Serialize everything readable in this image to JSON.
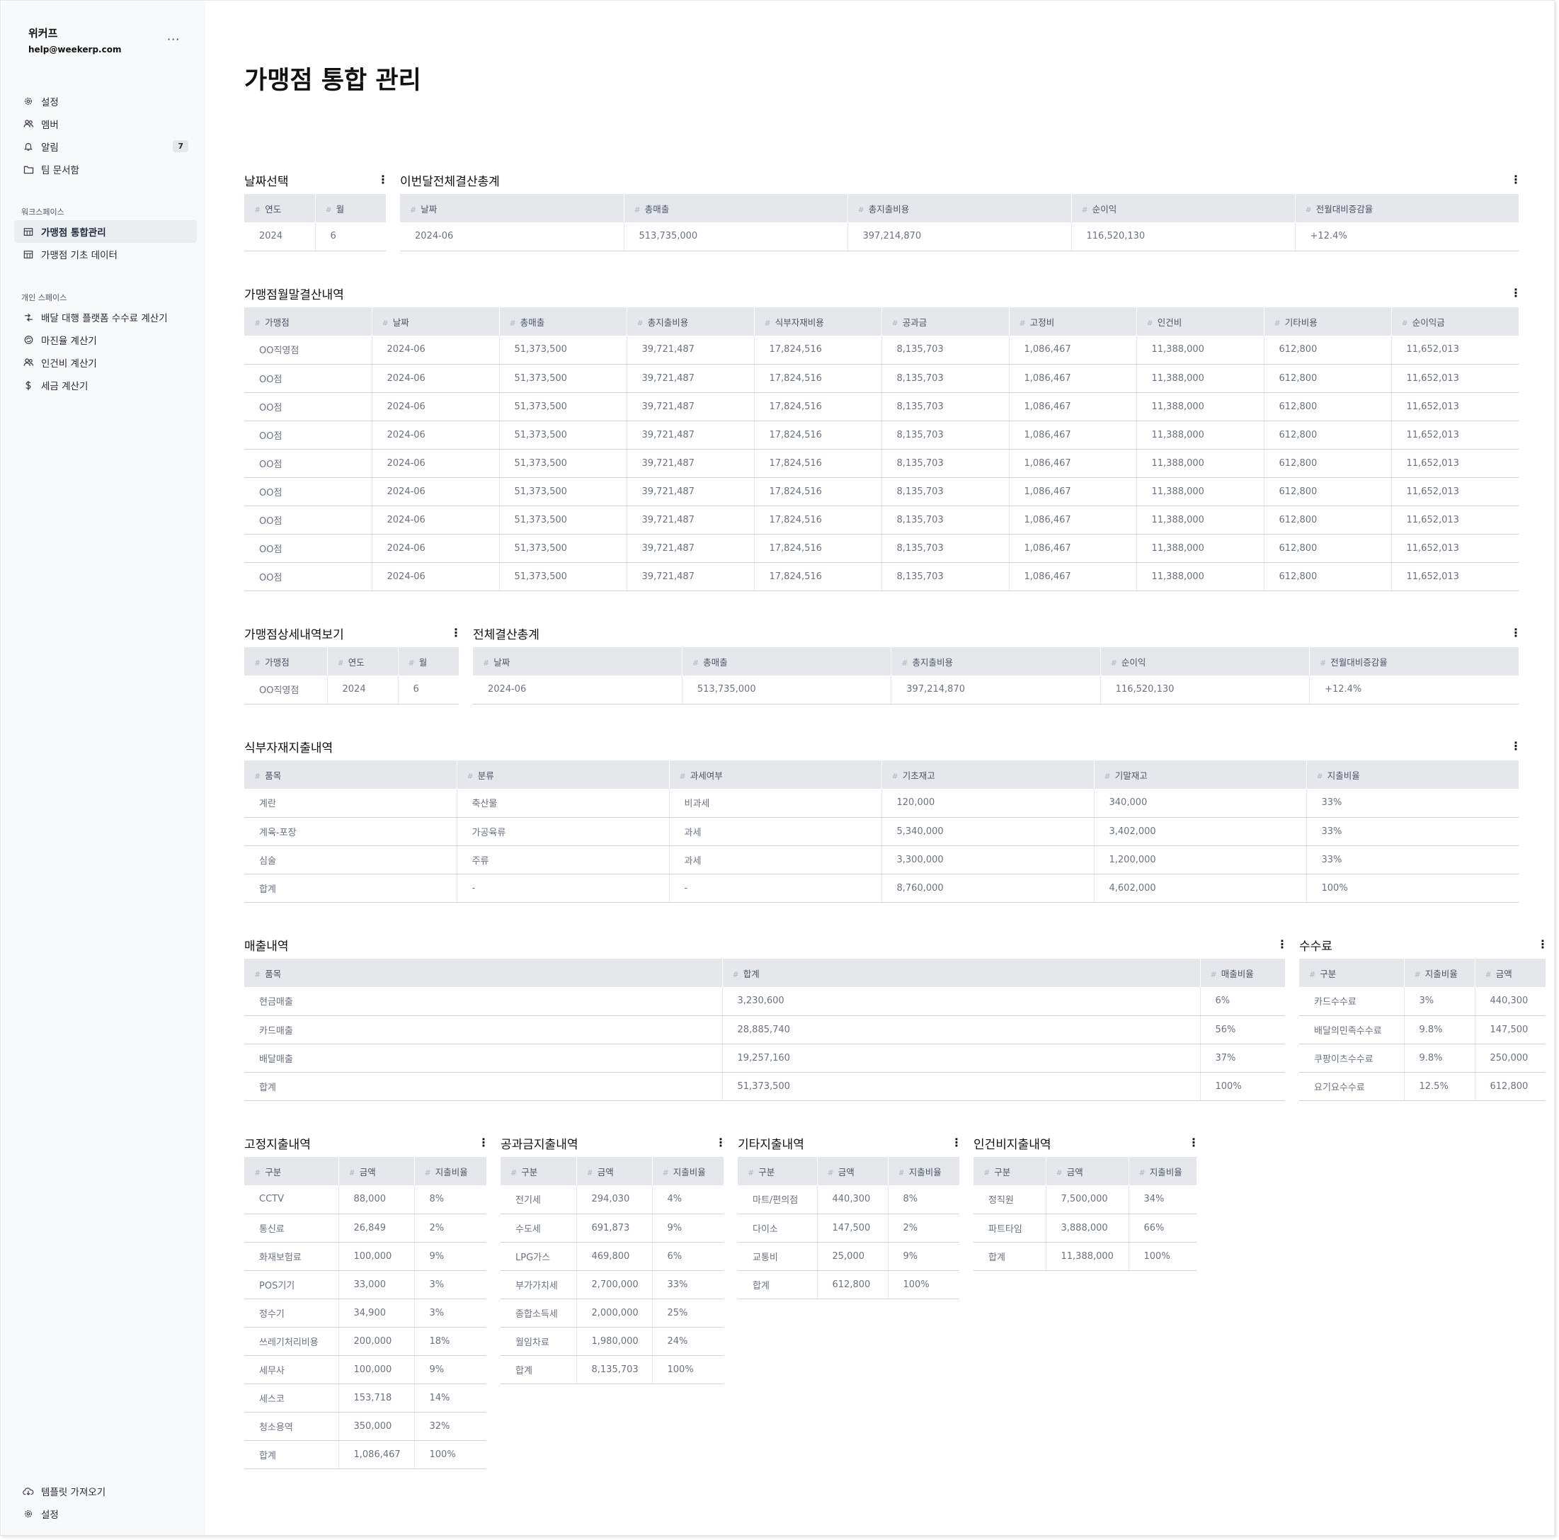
{
  "sidebar": {
    "workspace_name": "위커프",
    "email": "help@weekerp.com",
    "more": "···",
    "top_items": [
      {
        "label": "설정",
        "icon": "gear-icon"
      },
      {
        "label": "멤버",
        "icon": "users-icon"
      },
      {
        "label": "알림",
        "icon": "bell-icon",
        "badge": "7"
      },
      {
        "label": "팀 문서함",
        "icon": "folder-icon"
      }
    ],
    "workspace_caption": "워크스페이스",
    "workspace_items": [
      {
        "label": "가맹점 통합관리",
        "icon": "table-icon",
        "active": true
      },
      {
        "label": "가맹점 기초 데이터",
        "icon": "table-icon"
      }
    ],
    "personal_caption": "개인 스페이스",
    "personal_items": [
      {
        "label": "배달 대행 플랫폼 수수료 계산기",
        "icon": "arrows-icon"
      },
      {
        "label": "마진율 계산기",
        "icon": "coins-icon"
      },
      {
        "label": "인건비 계산기",
        "icon": "users-icon"
      },
      {
        "label": "세금 계산기",
        "icon": "dollar-icon"
      }
    ],
    "bottom_items": [
      {
        "label": "템플릿 가져오기",
        "icon": "cloud-download-icon"
      },
      {
        "label": "설정",
        "icon": "gear-icon"
      }
    ]
  },
  "page": {
    "title": "가맹점 통합 관리"
  },
  "sections": {
    "date_select": {
      "title": "날짜선택",
      "headers": [
        "연도",
        "월"
      ],
      "rows": [
        [
          "2024",
          "6"
        ]
      ]
    },
    "month_total": {
      "title": "이번달전체결산총계",
      "headers": [
        "날짜",
        "총매출",
        "총지출비용",
        "순이익",
        "전월대비증감율"
      ],
      "rows": [
        [
          "2024-06",
          "513,735,000",
          "397,214,870",
          "116,520,130",
          "+12.4%"
        ]
      ]
    },
    "monthly_settlement": {
      "title": "가맹점월말결산내역",
      "headers": [
        "가맹점",
        "날짜",
        "총매출",
        "총지출비용",
        "식부자재비용",
        "공과금",
        "고정비",
        "인건비",
        "기타비용",
        "순이익금"
      ],
      "rows": [
        [
          "OO직영점",
          "2024-06",
          "51,373,500",
          "39,721,487",
          "17,824,516",
          "8,135,703",
          "1,086,467",
          "11,388,000",
          "612,800",
          "11,652,013"
        ],
        [
          "OO점",
          "2024-06",
          "51,373,500",
          "39,721,487",
          "17,824,516",
          "8,135,703",
          "1,086,467",
          "11,388,000",
          "612,800",
          "11,652,013"
        ],
        [
          "OO점",
          "2024-06",
          "51,373,500",
          "39,721,487",
          "17,824,516",
          "8,135,703",
          "1,086,467",
          "11,388,000",
          "612,800",
          "11,652,013"
        ],
        [
          "OO점",
          "2024-06",
          "51,373,500",
          "39,721,487",
          "17,824,516",
          "8,135,703",
          "1,086,467",
          "11,388,000",
          "612,800",
          "11,652,013"
        ],
        [
          "OO점",
          "2024-06",
          "51,373,500",
          "39,721,487",
          "17,824,516",
          "8,135,703",
          "1,086,467",
          "11,388,000",
          "612,800",
          "11,652,013"
        ],
        [
          "OO점",
          "2024-06",
          "51,373,500",
          "39,721,487",
          "17,824,516",
          "8,135,703",
          "1,086,467",
          "11,388,000",
          "612,800",
          "11,652,013"
        ],
        [
          "OO점",
          "2024-06",
          "51,373,500",
          "39,721,487",
          "17,824,516",
          "8,135,703",
          "1,086,467",
          "11,388,000",
          "612,800",
          "11,652,013"
        ],
        [
          "OO점",
          "2024-06",
          "51,373,500",
          "39,721,487",
          "17,824,516",
          "8,135,703",
          "1,086,467",
          "11,388,000",
          "612,800",
          "11,652,013"
        ],
        [
          "OO점",
          "2024-06",
          "51,373,500",
          "39,721,487",
          "17,824,516",
          "8,135,703",
          "1,086,467",
          "11,388,000",
          "612,800",
          "11,652,013"
        ]
      ]
    },
    "store_detail": {
      "title": "가맹점상세내역보기",
      "headers": [
        "가맹점",
        "연도",
        "월"
      ],
      "rows": [
        [
          "OO직영점",
          "2024",
          "6"
        ]
      ]
    },
    "total_summary": {
      "title": "전체결산총계",
      "headers": [
        "날짜",
        "총매출",
        "총지출비용",
        "순이익",
        "전월대비증감율"
      ],
      "rows": [
        [
          "2024-06",
          "513,735,000",
          "397,214,870",
          "116,520,130",
          "+12.4%"
        ]
      ]
    },
    "food_expense": {
      "title": "식부자재지출내역",
      "headers": [
        "품목",
        "분류",
        "과세여부",
        "기초재고",
        "기말재고",
        "지출비율"
      ],
      "rows": [
        [
          "계란",
          "축산물",
          "비과세",
          "120,000",
          "340,000",
          "33%"
        ],
        [
          "계육-포장",
          "가공육류",
          "과세",
          "5,340,000",
          "3,402,000",
          "33%"
        ],
        [
          "심술",
          "주류",
          "과세",
          "3,300,000",
          "1,200,000",
          "33%"
        ],
        [
          "합계",
          "-",
          "-",
          "8,760,000",
          "4,602,000",
          "100%"
        ]
      ]
    },
    "sales": {
      "title": "매출내역",
      "headers": [
        "품목",
        "합계",
        "매출비율"
      ],
      "rows": [
        [
          "현금매출",
          "3,230,600",
          "6%"
        ],
        [
          "카드매출",
          "28,885,740",
          "56%"
        ],
        [
          "배달매출",
          "19,257,160",
          "37%"
        ],
        [
          "합계",
          "51,373,500",
          "100%"
        ]
      ]
    },
    "fees": {
      "title": "수수료",
      "headers": [
        "구분",
        "지출비율",
        "금액"
      ],
      "rows": [
        [
          "카드수수료",
          "3%",
          "440,300"
        ],
        [
          "배달의민족수수료",
          "9.8%",
          "147,500"
        ],
        [
          "쿠팡이츠수수료",
          "9.8%",
          "250,000"
        ],
        [
          "요기요수수료",
          "12.5%",
          "612,800"
        ]
      ]
    },
    "fixed_expense": {
      "title": "고정지출내역",
      "headers": [
        "구분",
        "금액",
        "지출비율"
      ],
      "rows": [
        [
          "CCTV",
          "88,000",
          "8%"
        ],
        [
          "통신료",
          "26,849",
          "2%"
        ],
        [
          "화재보험료",
          "100,000",
          "9%"
        ],
        [
          "POS기기",
          "33,000",
          "3%"
        ],
        [
          "정수기",
          "34,900",
          "3%"
        ],
        [
          "쓰레기처리비용",
          "200,000",
          "18%"
        ],
        [
          "세무사",
          "100,000",
          "9%"
        ],
        [
          "세스코",
          "153,718",
          "14%"
        ],
        [
          "청소용역",
          "350,000",
          "32%"
        ],
        [
          "합계",
          "1,086,467",
          "100%"
        ]
      ]
    },
    "utility_expense": {
      "title": "공과금지출내역",
      "headers": [
        "구분",
        "금액",
        "지출비율"
      ],
      "rows": [
        [
          "전기세",
          "294,030",
          "4%"
        ],
        [
          "수도세",
          "691,873",
          "9%"
        ],
        [
          "LPG가스",
          "469,800",
          "6%"
        ],
        [
          "부가가치세",
          "2,700,000",
          "33%"
        ],
        [
          "종합소득세",
          "2,000,000",
          "25%"
        ],
        [
          "월임차료",
          "1,980,000",
          "24%"
        ],
        [
          "합계",
          "8,135,703",
          "100%"
        ]
      ]
    },
    "other_expense": {
      "title": "기타지출내역",
      "headers": [
        "구분",
        "금액",
        "지출비율"
      ],
      "rows": [
        [
          "마트/편의점",
          "440,300",
          "8%"
        ],
        [
          "다이소",
          "147,500",
          "2%"
        ],
        [
          "교통비",
          "25,000",
          "9%"
        ],
        [
          "합계",
          "612,800",
          "100%"
        ]
      ]
    },
    "labor_expense": {
      "title": "인건비지출내역",
      "headers": [
        "구분",
        "금액",
        "지출비율"
      ],
      "rows": [
        [
          "정직원",
          "7,500,000",
          "34%"
        ],
        [
          "파트타임",
          "3,888,000",
          "66%"
        ],
        [
          "합계",
          "11,388,000",
          "100%"
        ]
      ]
    }
  }
}
